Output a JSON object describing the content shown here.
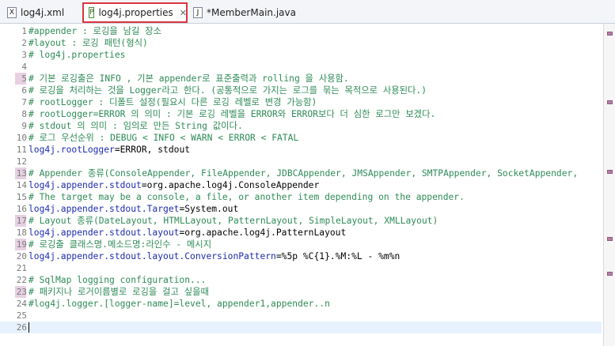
{
  "tabs": [
    {
      "label": "log4j.xml",
      "icon": "xml-file-icon",
      "glyph": "X",
      "active": false
    },
    {
      "label": "log4j.properties",
      "icon": "properties-file-icon",
      "glyph": "P",
      "active": true
    },
    {
      "label": "*MemberMain.java",
      "icon": "java-file-icon",
      "glyph": "J",
      "active": false
    }
  ],
  "close_glyph": "✕",
  "lines": [
    {
      "n": "1",
      "text": "#appender : 로깅을 남길 장소",
      "kind": "comment"
    },
    {
      "n": "2",
      "text": "#layout : 로깅 패턴(형식)",
      "kind": "comment"
    },
    {
      "n": "3",
      "text": "# log4j.properties",
      "kind": "comment"
    },
    {
      "n": "4",
      "text": "",
      "kind": "plain"
    },
    {
      "n": "5",
      "text": "# 기본 로깅출은 INFO , 기본 appender로 표준출력과 rolling 을 사용함.",
      "kind": "comment"
    },
    {
      "n": "6",
      "text": "# 로깅을 처리하는 것을 Logger라고 한다. (공통적으로 가지는 로그를 묶는 목적으로 사용된다.)",
      "kind": "comment"
    },
    {
      "n": "7",
      "text": "# rootLogger : 디폴트 설정(필요시 다른 로깅 레벨로 변경 가능함)",
      "kind": "comment"
    },
    {
      "n": "8",
      "text": "# rootLogger=ERROR 의 의미 : 기본 로깅 레벨을 ERROR와 ERROR보다 더 심한 로그만 보겠다.",
      "kind": "comment"
    },
    {
      "n": "9",
      "text": "# stdout 의 의미 : 임의로 만든 String 값이다.",
      "kind": "comment"
    },
    {
      "n": "10",
      "text": "# 로그 우선순위 : DEBUG < INFO < WARN < ERROR < FATAL",
      "kind": "comment"
    },
    {
      "n": "11",
      "key": "log4j.rootLogger",
      "value": "=ERROR, stdout",
      "kind": "prop"
    },
    {
      "n": "12",
      "text": "",
      "kind": "plain"
    },
    {
      "n": "13",
      "text": "# Appender 종류(ConsoleAppender, FileAppender, JDBCAppender, JMSAppender, SMTPAppender, SocketAppender,",
      "kind": "comment"
    },
    {
      "n": "14",
      "key": "log4j.appender.stdout",
      "value": "=org.apache.log4j.ConsoleAppender",
      "kind": "prop"
    },
    {
      "n": "15",
      "text": "# The target may be a console, a file, or another item depending on the appender.",
      "kind": "comment"
    },
    {
      "n": "16",
      "key": "log4j.appender.stdout.Target",
      "value": "=System.out",
      "kind": "prop"
    },
    {
      "n": "17",
      "text": "# Layout 종류(DateLayout, HTMLLayout, PatternLayout, SimpleLayout, XMLLayout)",
      "kind": "comment"
    },
    {
      "n": "18",
      "key": "log4j.appender.stdout.layout",
      "value": "=org.apache.log4j.PatternLayout",
      "kind": "prop"
    },
    {
      "n": "19",
      "text": "# 로깅출 클래스명.메소드명:라인수 - 메시지",
      "kind": "comment"
    },
    {
      "n": "20",
      "key": "log4j.appender.stdout.layout.ConversionPattern",
      "value": "=%5p %C{1}.%M:%L - %m%n",
      "kind": "prop"
    },
    {
      "n": "21",
      "text": "",
      "kind": "plain"
    },
    {
      "n": "22",
      "text": "# SqlMap logging configuration...",
      "kind": "comment"
    },
    {
      "n": "23",
      "text": "# 패키지나 로거이름별로 로깅을 걸고 싶을때",
      "kind": "comment"
    },
    {
      "n": "24",
      "text": "#log4j.logger.[logger-name]=level, appender1,appender..n",
      "kind": "comment"
    },
    {
      "n": "25",
      "text": "",
      "kind": "plain"
    },
    {
      "n": "26",
      "text": "",
      "kind": "current"
    }
  ],
  "changed_lines": [
    "5",
    "13",
    "17",
    "19",
    "23"
  ],
  "colors": {
    "comment": "#2e8b57",
    "key": "#1c2cae",
    "active_tab_outline": "#d9363e",
    "change_marker": "#e7d0e2",
    "current_line": "#e8f2fe"
  }
}
